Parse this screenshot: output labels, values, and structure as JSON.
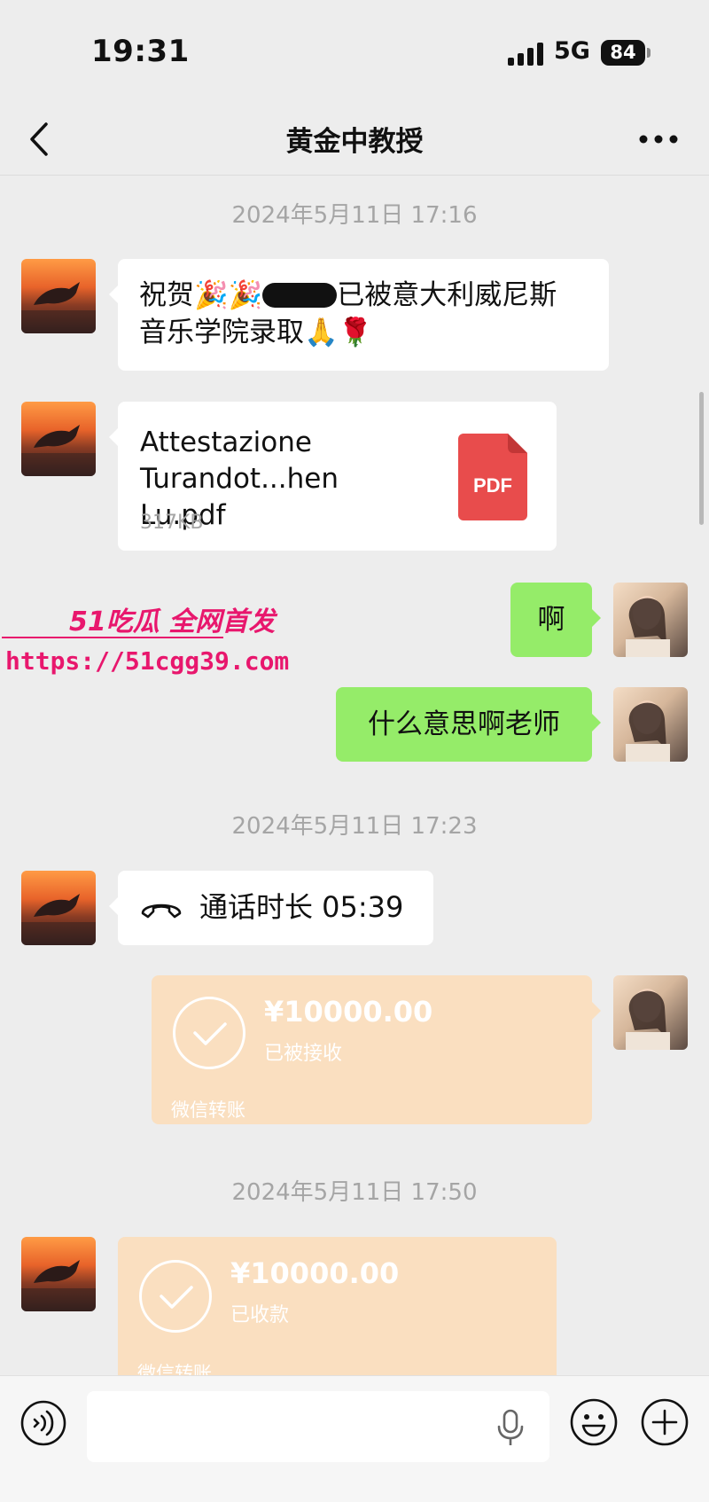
{
  "status_bar": {
    "time": "19:31",
    "network": "5G",
    "battery": "84"
  },
  "nav": {
    "title": "黄金中教授"
  },
  "timestamps": [
    "2024年5月11日 17:16",
    "2024年5月11日 17:23",
    "2024年5月11日 17:50"
  ],
  "messages": {
    "congrats": {
      "line1_prefix": "祝贺🎉🎉",
      "line1_suffix": "已被意大利威尼斯",
      "line2": "音乐学院录取🙏🌹"
    },
    "file": {
      "name": "Attestazione Turandot...hen Lu.pdf",
      "size": "317KB",
      "badge": "PDF"
    },
    "reply1": "啊",
    "reply2": "什么意思啊老师",
    "call": {
      "text": "通话时长 05:39"
    },
    "transfer_sent": {
      "amount": "¥10000.00",
      "status": "已被接收",
      "footer": "微信转账"
    },
    "transfer_received": {
      "amount": "¥10000.00",
      "status": "已收款",
      "footer": "微信转账"
    }
  },
  "watermark": {
    "brand": "51吃瓜 全网首发",
    "url": "https://51cgg39.com"
  },
  "colors": {
    "bubble_green": "#95ec69",
    "transfer_orange": "#fadfc0",
    "pdf_red": "#e84c4c",
    "watermark": "#e8176d"
  },
  "icons": [
    "back-icon",
    "more-icon",
    "phone-icon",
    "check-icon",
    "pdf-icon",
    "voice-icon",
    "mic-icon",
    "emoji-icon",
    "plus-icon"
  ]
}
